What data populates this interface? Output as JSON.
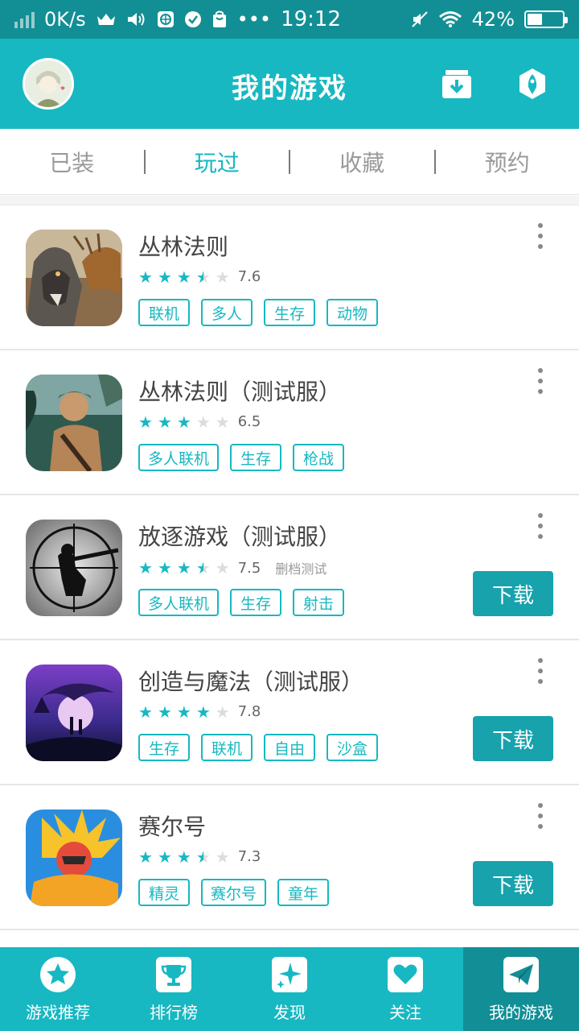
{
  "status_bar": {
    "net_speed": "0K/s",
    "time": "19:12",
    "battery_percent": "42%",
    "battery_level": 0.42,
    "dots": "•••"
  },
  "header": {
    "title": "我的游戏",
    "avatar_icon": "avatar",
    "left_action_icon": "download-box-icon",
    "right_action_icon": "rocket-icon"
  },
  "tabs": [
    {
      "label": "已装",
      "active": false
    },
    {
      "label": "玩过",
      "active": true
    },
    {
      "label": "收藏",
      "active": false
    },
    {
      "label": "预约",
      "active": false
    }
  ],
  "games": [
    {
      "name": "丛林法则",
      "rating": 7.6,
      "stars": 3.5,
      "score_text": "7.6",
      "note": "",
      "tags": [
        "联机",
        "多人",
        "生存",
        "动物"
      ],
      "download": ""
    },
    {
      "name": "丛林法则（测试服）",
      "rating": 6.5,
      "stars": 3.0,
      "score_text": "6.5",
      "note": "",
      "tags": [
        "多人联机",
        "生存",
        "枪战"
      ],
      "download": ""
    },
    {
      "name": "放逐游戏（测试服）",
      "rating": 7.5,
      "stars": 3.5,
      "score_text": "7.5",
      "note": "删档测试",
      "tags": [
        "多人联机",
        "生存",
        "射击"
      ],
      "download": "下载"
    },
    {
      "name": "创造与魔法（测试服）",
      "rating": 7.8,
      "stars": 4.0,
      "score_text": "7.8",
      "note": "",
      "tags": [
        "生存",
        "联机",
        "自由",
        "沙盒"
      ],
      "download": "下载"
    },
    {
      "name": "赛尔号",
      "rating": 7.3,
      "stars": 3.5,
      "score_text": "7.3",
      "note": "",
      "tags": [
        "精灵",
        "赛尔号",
        "童年"
      ],
      "download": "下载"
    }
  ],
  "bottom_nav": [
    {
      "label": "游戏推荐",
      "icon": "star-icon",
      "active": false
    },
    {
      "label": "排行榜",
      "icon": "trophy-icon",
      "active": false
    },
    {
      "label": "发现",
      "icon": "sparkle-icon",
      "active": false
    },
    {
      "label": "关注",
      "icon": "heart-icon",
      "active": false
    },
    {
      "label": "我的游戏",
      "icon": "paper-plane-icon",
      "active": true
    }
  ],
  "colors": {
    "primary": "#17b8c2",
    "status_bar": "#128f95",
    "nav_active": "#128e96",
    "download_button": "#17a2ac"
  }
}
